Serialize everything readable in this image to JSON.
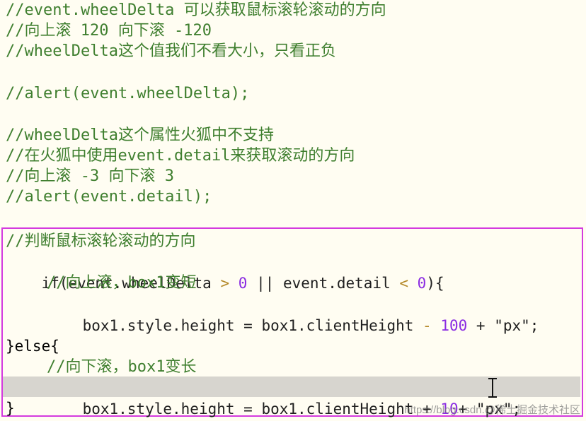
{
  "comments_top": [
    "//event.wheelDelta 可以获取鼠标滚轮滚动的方向",
    "//向上滚 120 向下滚 -120",
    "//wheelDelta这个值我们不看大小，只看正负",
    "//alert(event.wheelDelta);",
    "//wheelDelta这个属性火狐中不支持",
    "//在火狐中使用event.detail来获取滚动的方向",
    "//向上滚 -3 向下滚 3",
    "//alert(event.detail);"
  ],
  "highlighted_code": {
    "comment_1": "//判断鼠标滚轮滚动的方向",
    "if_line": {
      "prefix": "if(event.wheelDelta ",
      "op1": ">",
      "space1": " ",
      "num1": "0",
      "mid": " || event.detail ",
      "op2": "<",
      "space2": " ",
      "num2": "0",
      "suffix": "){"
    },
    "comment_2": "//向上滚，box1变短",
    "line_up": {
      "prefix": "box1.style.height = box1.clientHeight ",
      "op": "-",
      "space": " ",
      "num": "100",
      "suffix": " + \"px\";"
    },
    "else_line": "}else{",
    "comment_3": "//向下滚，box1变长",
    "line_down": {
      "prefix": "box1.style.height = box1.clientHeight + ",
      "num": "10",
      "suffix": "+ \"px\";"
    },
    "closing": "}"
  },
  "watermark": "https://blog.csdn.@稀土掘金技术社区",
  "colors": {
    "background": "#fffdf2",
    "comment": "#3f7f2f",
    "code": "#202020",
    "number": "#8a2be2",
    "operator": "#b58a2a",
    "highlight_border": "#d43adf"
  }
}
